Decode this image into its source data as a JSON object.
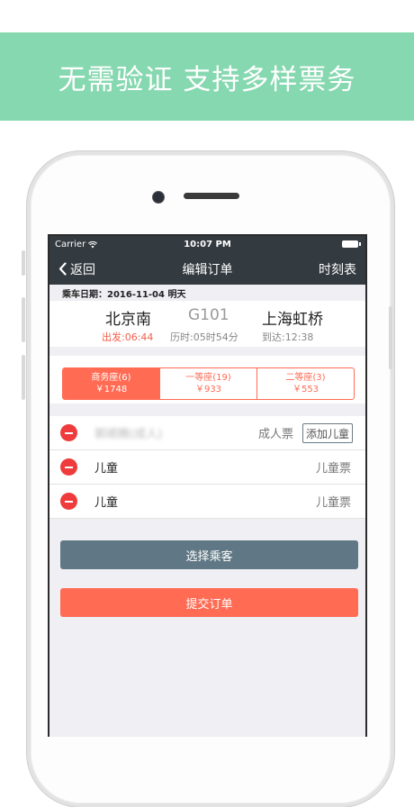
{
  "banner": {
    "text": "无需验证 支持多样票务"
  },
  "status": {
    "carrier": "Carrier",
    "time": "10:07 PM"
  },
  "nav": {
    "back": "返回",
    "title": "编辑订单",
    "right": "时刻表"
  },
  "trip": {
    "date_label": "乘车日期：2016-11-04 明天",
    "from": "北京南",
    "train_no": "G101",
    "to": "上海虹桥",
    "depart": "出发:06:44",
    "duration": "历时:05时54分",
    "arrive": "到达:12:38"
  },
  "seats": [
    {
      "name": "商务座(6)",
      "price": "￥1748",
      "active": true
    },
    {
      "name": "一等座(19)",
      "price": "￥933",
      "active": false
    },
    {
      "name": "二等座(3)",
      "price": "￥553",
      "active": false
    }
  ],
  "passengers": [
    {
      "name": "郭顺腾(成人)",
      "type": "成人票",
      "blurred": true
    },
    {
      "name": "儿童",
      "type": "儿童票",
      "blurred": false
    },
    {
      "name": "儿童",
      "type": "儿童票",
      "blurred": false
    }
  ],
  "add_child_label": "添加儿童",
  "buttons": {
    "select": "选择乘客",
    "submit": "提交订单"
  },
  "colors": {
    "banner": "#86d8b0",
    "accent": "#ff6b53",
    "nav": "#333a40",
    "select_btn": "#607885",
    "remove": "#ef3b3b"
  }
}
